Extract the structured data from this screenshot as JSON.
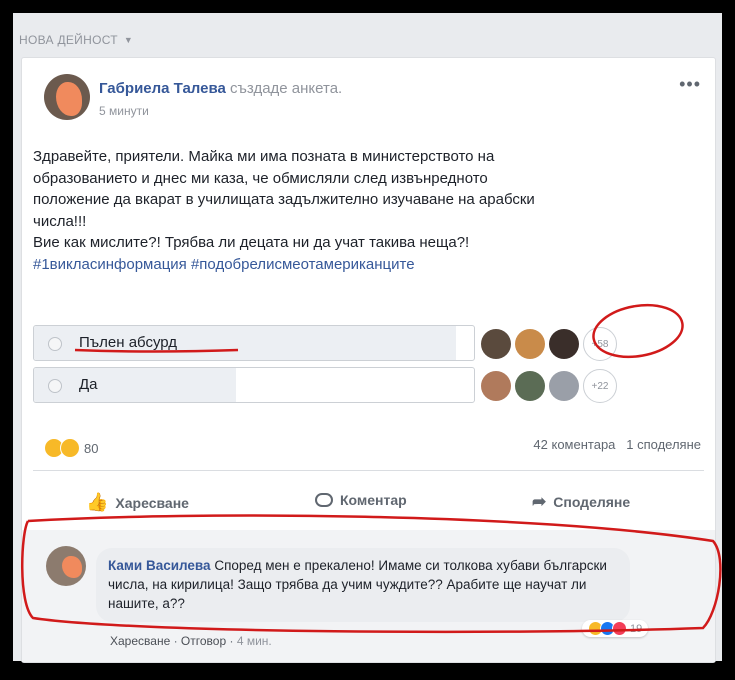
{
  "feed": {
    "header": "НОВА ДЕЙНОСТ"
  },
  "post": {
    "author": "Габриела Талева",
    "action": "създаде анкета.",
    "time": "5 минути",
    "text_lines": [
      "Здравейте, приятели. Майка ми има позната в министерството на",
      "образованието и днес ми каза, че обмисляли след извънредното",
      "положение да вкарат в училищата задължително изучаване на арабски",
      "числа!!!",
      "Вие как мислите?! Трябва ли децата ни да учат такива неща?!"
    ],
    "hashtags": "#1викласинформация #подобрелисмеотамериканците"
  },
  "poll": {
    "options": [
      {
        "label": "Пълен абсурд",
        "more_count": "+58",
        "share": 0.58
      },
      {
        "label": "Да",
        "more_count": "+22",
        "share": 0.22
      }
    ]
  },
  "reactions": {
    "count": "80"
  },
  "stats": {
    "comments": "42 коментара",
    "shares": "1 споделяне"
  },
  "actions": {
    "like": "Харесване",
    "comment": "Коментар",
    "share": "Споделяне"
  },
  "comment": {
    "author": "Ками Василева",
    "text": "Според мен е прекалено! Имаме си толкова хубави български числа, на кирилица! Защо трябва да учим чуждите?? Арабите ще научат ли нашите, а??",
    "reaction_count": "19",
    "like": "Харесване",
    "reply": "Отговор",
    "time": "4 мин."
  },
  "colors": {
    "link": "#365899",
    "annotation": "#d11a1a",
    "card": "#ffffff"
  }
}
